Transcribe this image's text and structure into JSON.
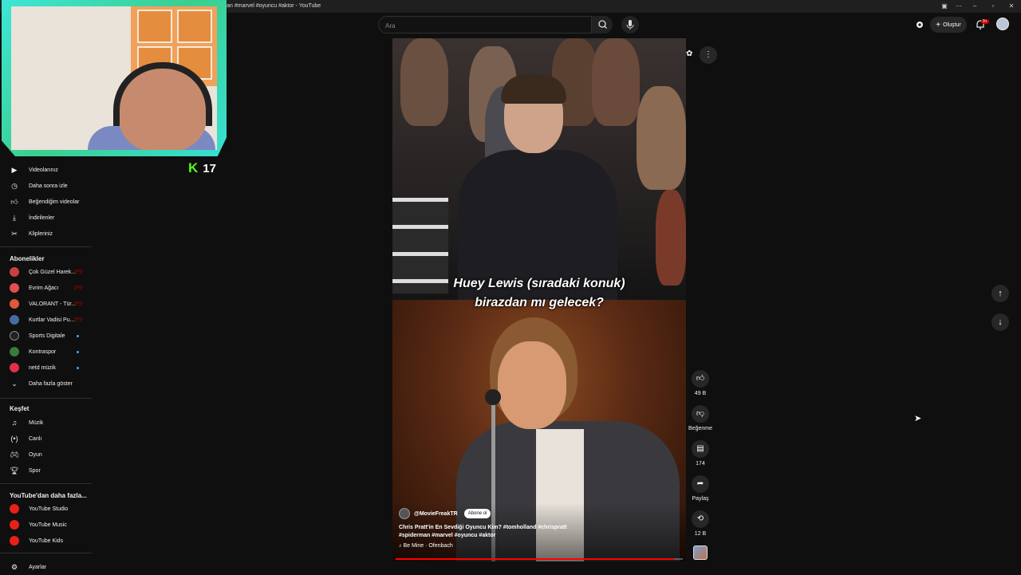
{
  "window": {
    "title": "rman #marvel #oyuncu #aktor - YouTube"
  },
  "search": {
    "placeholder": "Ara"
  },
  "header": {
    "create_label": "Oluştur",
    "notif_count": "9+"
  },
  "stream": {
    "viewer_count": "17"
  },
  "sidebar": {
    "you_items": [
      {
        "label": "Videolarınız",
        "icon": "video-icon"
      },
      {
        "label": "Daha sonra izle",
        "icon": "clock-icon"
      },
      {
        "label": "Beğendiğim videolar",
        "icon": "thumbs-up-icon"
      },
      {
        "label": "İndirilenler",
        "icon": "download-icon"
      },
      {
        "label": "Klipleriniz",
        "icon": "scissors-icon"
      }
    ],
    "subs_header": "Abonelikler",
    "subscriptions": [
      {
        "label": "Çok Güzel Harek...",
        "status": "live",
        "color": "#c94040"
      },
      {
        "label": "Evrim Ağacı",
        "status": "live",
        "color": "#e05050"
      },
      {
        "label": "VALORANT - Tür...",
        "status": "live",
        "color": "#e0583a"
      },
      {
        "label": "Kurtlar Vadisi Pu...",
        "status": "live",
        "color": "#4a6aa0"
      },
      {
        "label": "Sports Digitale",
        "status": "new",
        "color": "#222222"
      },
      {
        "label": "Kontraspor",
        "status": "new",
        "color": "#3a7a3a"
      },
      {
        "label": "netd müzik",
        "status": "new",
        "color": "#e0304a"
      }
    ],
    "show_more": "Daha fazla göster",
    "explore_header": "Keşfet",
    "explore": [
      {
        "label": "Müzik",
        "icon": "music-icon"
      },
      {
        "label": "Canlı",
        "icon": "live-icon"
      },
      {
        "label": "Oyun",
        "icon": "gamepad-icon"
      },
      {
        "label": "Spor",
        "icon": "trophy-icon"
      }
    ],
    "more_header": "YouTube'dan daha fazla...",
    "more": [
      {
        "label": "YouTube Studio"
      },
      {
        "label": "YouTube Music"
      },
      {
        "label": "YouTube Kids"
      }
    ],
    "settings": "Ayarlar"
  },
  "short": {
    "caption_line1": "Huey Lewis (sıradaki konuk)",
    "caption_line2": "birazdan mı gelecek?",
    "channel": "@MovieFreakTR",
    "subscribe_label": "Abone ol",
    "title": "Chris Pratt'in En Sevdiği Oyuncu Kim? #tomholland #chrispratt #spiderman #marvel #oyuncu #aktor",
    "music": "Be Mine · Ofenbach",
    "progress": 0.97
  },
  "actions": {
    "likes": "49 B",
    "dislike_label": "Beğenme",
    "comments": "174",
    "share_label": "Paylaş",
    "remix": "12 B"
  },
  "colors": {
    "accent": "#ff0000",
    "kick_green": "#53fc18",
    "webcam_frame": "#3ce6d8"
  }
}
